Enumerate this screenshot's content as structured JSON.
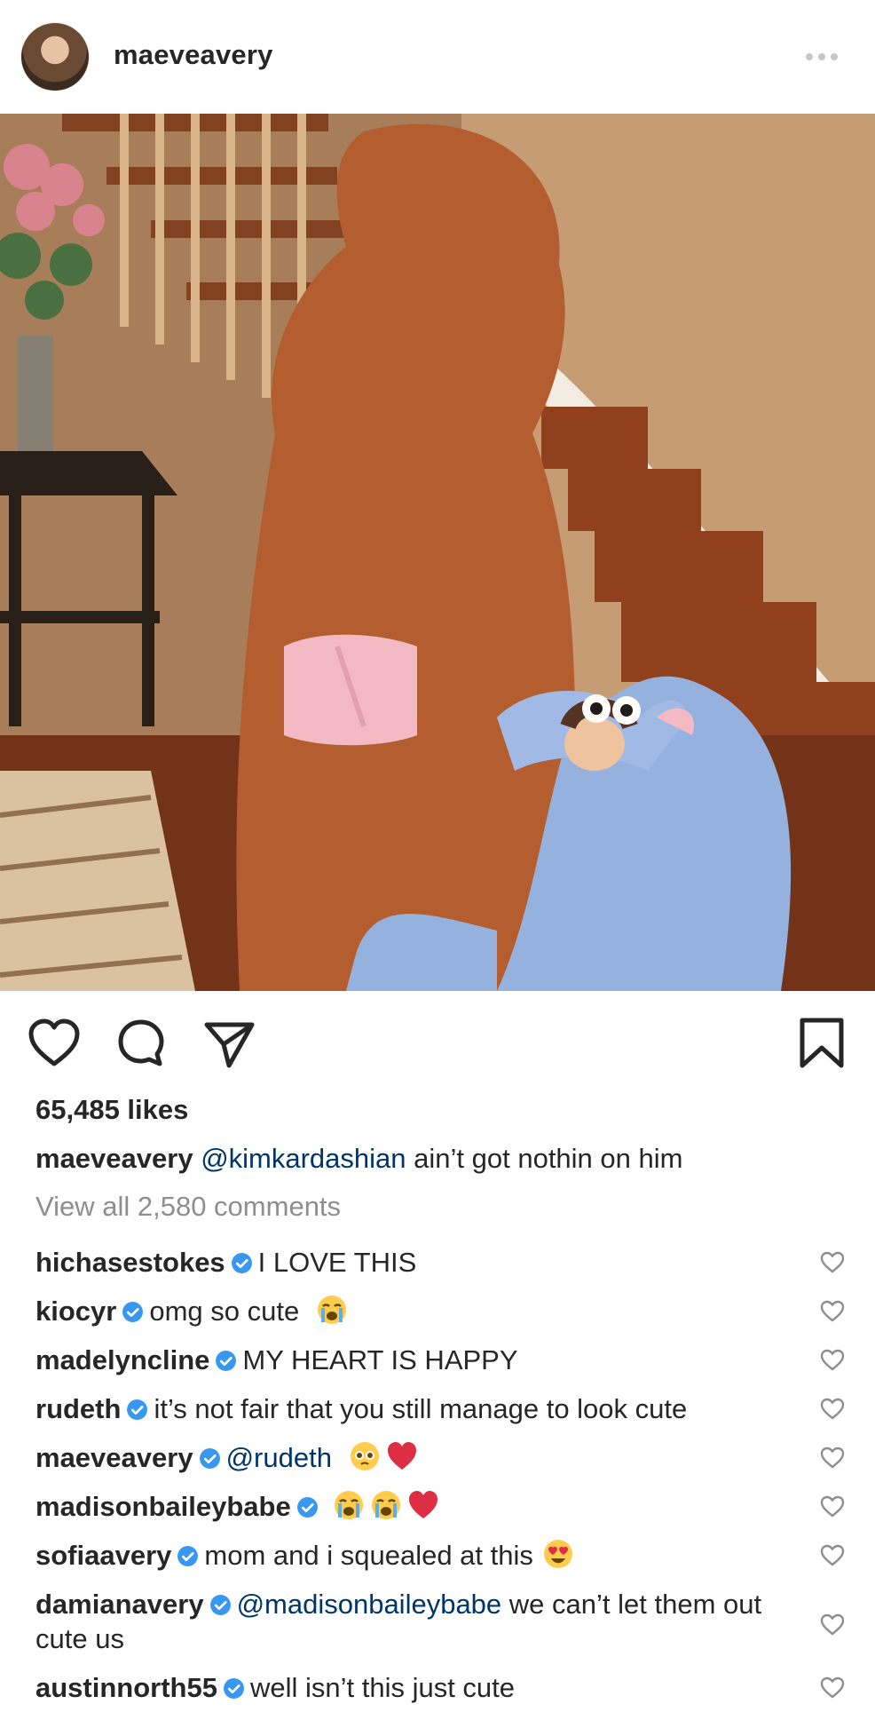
{
  "post": {
    "username": "maeveavery",
    "likes": "65,485 likes",
    "caption": {
      "user": "maeveavery",
      "mention": "@kimkardashian",
      "text": " ain’t got nothin on him"
    },
    "view_all": "View all 2,580 comments",
    "comments": [
      {
        "user": "hichasestokes",
        "text": "I LOVE THIS",
        "emojis": []
      },
      {
        "user": "kiocyr",
        "text": "omg so cute",
        "emojis": [
          "loudly-crying-face"
        ]
      },
      {
        "user": "madelyncline",
        "text": "MY HEART IS HAPPY",
        "emojis": []
      },
      {
        "user": "rudeth",
        "text": "it’s not fair that you still manage to look cute",
        "emojis": []
      },
      {
        "user": "maeveavery",
        "mention": "@rudeth",
        "text": "",
        "emojis": [
          "pleading-face",
          "red-heart"
        ]
      },
      {
        "user": "madisonbaileybabe",
        "text": "",
        "emojis": [
          "loudly-crying-face",
          "loudly-crying-face",
          "red-heart"
        ]
      },
      {
        "user": "sofiaavery",
        "text": "mom and i squealed at this",
        "emojis": [
          "heart-eyes-face"
        ]
      },
      {
        "user": "damianavery",
        "mention": "@madisonbaileybabe",
        "text": " we can’t let them out cute us",
        "emojis": []
      },
      {
        "user": "austinnorth55",
        "text": "well isn’t this just cute",
        "emojis": []
      }
    ],
    "colors": {
      "text": "#262626",
      "muted": "#8e8e8e",
      "mention": "#003569",
      "verified": "#3897f0"
    }
  }
}
